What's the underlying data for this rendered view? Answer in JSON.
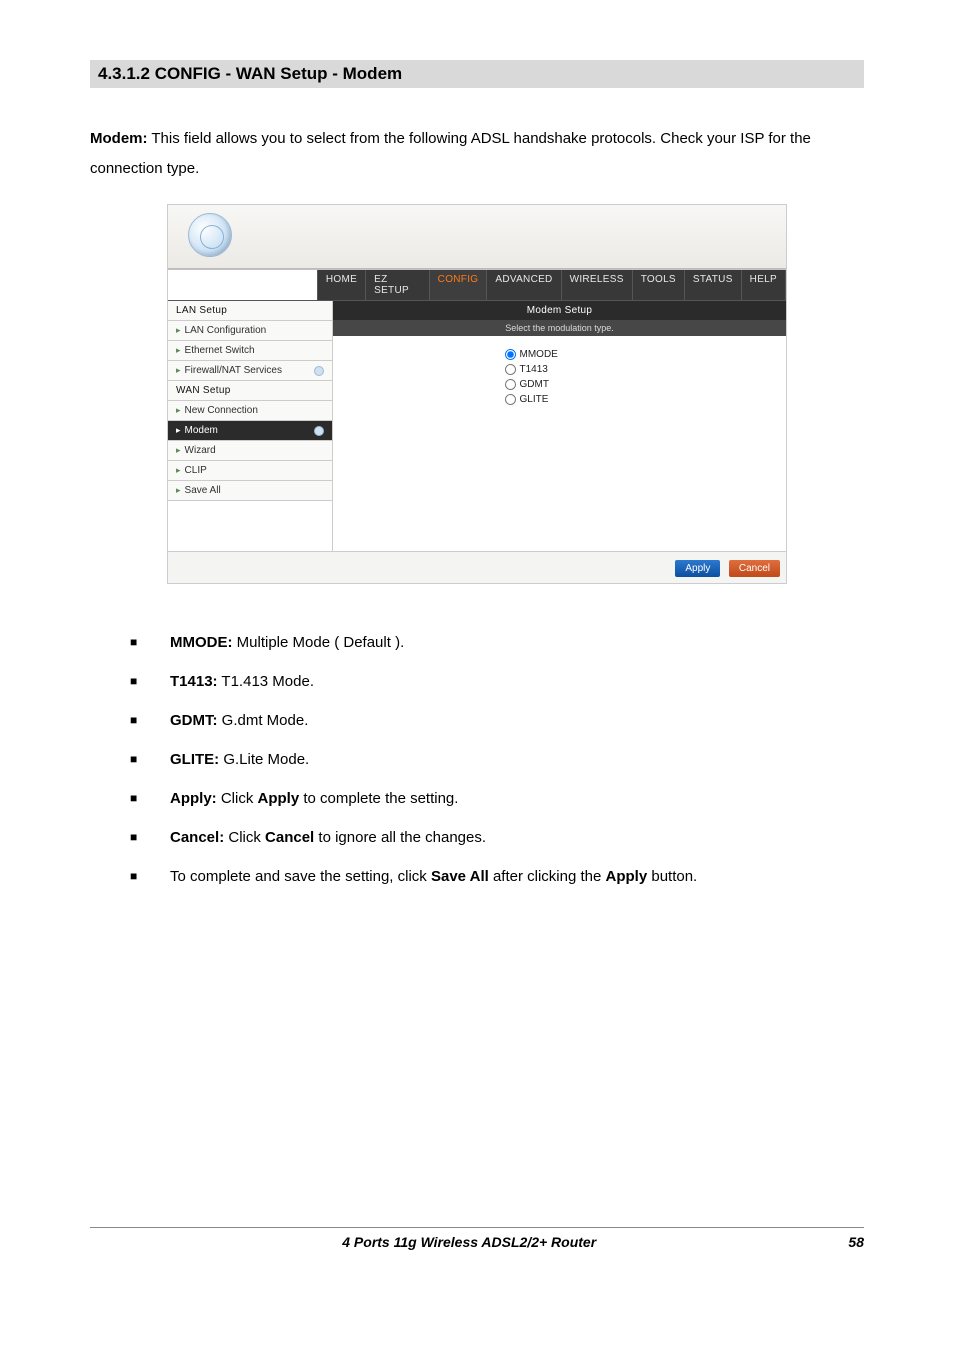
{
  "domain": "Document",
  "section_heading": "4.3.1.2 CONFIG - WAN Setup - Modem",
  "intro": {
    "label": "Modem:",
    "text": " This field allows you to select from the following ADSL handshake protocols. Check your ISP for the connection type."
  },
  "screenshot": {
    "tabs": [
      "HOME",
      "EZ SETUP",
      "CONFIG",
      "ADVANCED",
      "WIRELESS",
      "TOOLS",
      "STATUS",
      "HELP"
    ],
    "active_tab": "CONFIG",
    "sidebar": [
      {
        "label": "LAN Setup",
        "type": "heading"
      },
      {
        "label": "LAN Configuration",
        "type": "sub"
      },
      {
        "label": "Ethernet Switch",
        "type": "sub"
      },
      {
        "label": "Firewall/NAT Services",
        "type": "sub",
        "gear": true
      },
      {
        "label": "WAN Setup",
        "type": "heading"
      },
      {
        "label": "New Connection",
        "type": "sub"
      },
      {
        "label": "Modem",
        "type": "sub",
        "active": true,
        "gear": true
      },
      {
        "label": "Wizard",
        "type": "sub"
      },
      {
        "label": "CLIP",
        "type": "sub"
      },
      {
        "label": "Save All",
        "type": "sub"
      }
    ],
    "panel_title": "Modem Setup",
    "panel_subtitle": "Select the modulation type.",
    "radios": [
      {
        "label": "MMODE",
        "checked": true
      },
      {
        "label": "T1413",
        "checked": false
      },
      {
        "label": "GDMT",
        "checked": false
      },
      {
        "label": "GLITE",
        "checked": false
      }
    ],
    "buttons": {
      "apply": "Apply",
      "cancel": "Cancel"
    }
  },
  "bullets": [
    {
      "b": "MMODE:",
      "t": " Multiple Mode ( Default )."
    },
    {
      "b": "T1413:",
      "t": " T1.413 Mode."
    },
    {
      "b": "GDMT:",
      "t": " G.dmt Mode."
    },
    {
      "b": "GLITE:",
      "t": " G.Lite Mode."
    },
    {
      "b": "Apply:",
      "t_pre": " Click ",
      "b2": "Apply",
      "t_post": " to complete the setting."
    },
    {
      "b": "Cancel:",
      "t_pre": " Click ",
      "b2": "Cancel",
      "t_post": " to ignore all the changes."
    },
    {
      "t_pre": "To complete and save the setting, click ",
      "b2": "Save All",
      "t_mid": " after clicking the ",
      "b3": "Apply",
      "t_post": " button."
    }
  ],
  "footer": {
    "title": "4 Ports 11g Wireless ADSL2/2+ Router",
    "page": "58"
  }
}
